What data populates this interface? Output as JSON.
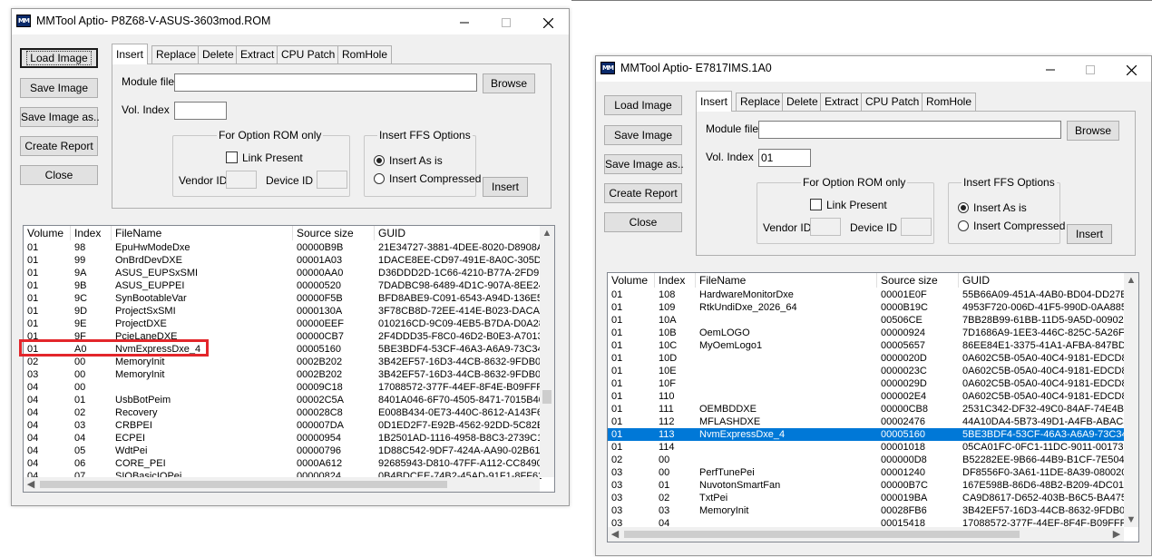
{
  "window_a": {
    "title": "MMTool Aptio- P8Z68-V-ASUS-3603mod.ROM",
    "buttons": {
      "load": "Load Image",
      "save": "Save Image",
      "save_as": "Save Image as..",
      "report": "Create Report",
      "close": "Close"
    },
    "tabs": [
      "Insert",
      "Replace",
      "Delete",
      "Extract",
      "CPU Patch",
      "RomHole"
    ],
    "module_file_label": "Module file",
    "module_file_value": "",
    "browse": "Browse",
    "vol_index_label": "Vol. Index",
    "vol_index_value": "",
    "option_rom_title": "For Option ROM only",
    "link_present": "Link Present",
    "vendor_id": "Vendor ID",
    "device_id": "Device ID",
    "ffs_title": "Insert FFS Options",
    "insert_as_is": "Insert As is",
    "insert_compressed": "Insert Compressed",
    "insert_button": "Insert",
    "columns": [
      "Volume",
      "Index",
      "FileName",
      "Source size",
      "GUID"
    ],
    "rows": [
      [
        "01",
        "98",
        "EpuHwModeDxe",
        "00000B9B",
        "21E34727-3881-4DEE-8020-D8908A"
      ],
      [
        "01",
        "99",
        "OnBrdDevDXE",
        "00001A03",
        "1DACE8EE-CD97-491E-8A0C-305D6"
      ],
      [
        "01",
        "9A",
        "ASUS_EUPSxSMI",
        "00000AA0",
        "D36DDD2D-1C66-4210-B77A-2FD9F"
      ],
      [
        "01",
        "9B",
        "ASUS_EUPPEI",
        "00000520",
        "7DADBC98-6489-4D1C-907A-8EE24"
      ],
      [
        "01",
        "9C",
        "SynBootableVar",
        "00000F5B",
        "BFD8ABE9-C091-6543-A94D-136E5E"
      ],
      [
        "01",
        "9D",
        "ProjectSxSMI",
        "0000130A",
        "3F78CB8D-72EE-414E-B023-DACA0"
      ],
      [
        "01",
        "9E",
        "ProjectDXE",
        "00000EEF",
        "010216CD-9C09-4EB5-B7DA-D0A28"
      ],
      [
        "01",
        "9F",
        "PcieLaneDXE",
        "00000CB7",
        "2F4DDD35-F8C0-46D2-B0E3-A7013"
      ],
      [
        "01",
        "A0",
        "NvmExpressDxe_4",
        "00005160",
        "5BE3BDF4-53CF-46A3-A6A9-73C34"
      ],
      [
        "02",
        "00",
        "MemoryInit",
        "0002B202",
        "3B42EF57-16D3-44CB-8632-9FDB06"
      ],
      [
        "03",
        "00",
        "MemoryInit",
        "0002B202",
        "3B42EF57-16D3-44CB-8632-9FDB06"
      ],
      [
        "04",
        "00",
        "",
        "00009C18",
        "17088572-377F-44EF-8F4E-B09FFF4"
      ],
      [
        "04",
        "01",
        "UsbBotPeim",
        "00002C5A",
        "8401A046-6F70-4505-8471-7015B40"
      ],
      [
        "04",
        "02",
        "Recovery",
        "000028C8",
        "E008B434-0E73-440C-8612-A143F6A"
      ],
      [
        "04",
        "03",
        "CRBPEI",
        "000007DA",
        "0D1ED2F7-E92B-4562-92DD-5C82E"
      ],
      [
        "04",
        "04",
        "ECPEI",
        "00000954",
        "1B2501AD-1116-4958-B8C3-2739C1"
      ],
      [
        "04",
        "05",
        "WdtPei",
        "00000796",
        "1D88C542-9DF7-424A-AA90-02B61F"
      ],
      [
        "04",
        "06",
        "CORE_PEI",
        "0000A612",
        "92685943-D810-47FF-A112-CC8490"
      ],
      [
        "04",
        "07",
        "SIOBasicIOPei",
        "00000824",
        "0B4BDCEE-74B2-45AD-91F1-8FF634"
      ]
    ],
    "highlighted_row": 8
  },
  "window_b": {
    "title": "MMTool Aptio- E7817IMS.1A0",
    "buttons": {
      "load": "Load Image",
      "save": "Save Image",
      "save_as": "Save Image as..",
      "report": "Create Report",
      "close": "Close"
    },
    "tabs": [
      "Insert",
      "Replace",
      "Delete",
      "Extract",
      "CPU Patch",
      "RomHole"
    ],
    "module_file_label": "Module file",
    "module_file_value": "",
    "browse": "Browse",
    "vol_index_label": "Vol. Index",
    "vol_index_value": "01",
    "option_rom_title": "For Option ROM only",
    "link_present": "Link Present",
    "vendor_id": "Vendor ID",
    "device_id": "Device ID",
    "ffs_title": "Insert FFS Options",
    "insert_as_is": "Insert As is",
    "insert_compressed": "Insert Compressed",
    "insert_button": "Insert",
    "columns": [
      "Volume",
      "Index",
      "FileName",
      "Source size",
      "GUID"
    ],
    "rows": [
      [
        "01",
        "108",
        "HardwareMonitorDxe",
        "00001E0F",
        "55B66A09-451A-4AB0-BD04-DD27E"
      ],
      [
        "01",
        "109",
        "RtkUndiDxe_2026_64",
        "0000B19C",
        "4953F720-006D-41F5-990D-0AA885"
      ],
      [
        "01",
        "10A",
        "",
        "00506CE",
        "7BB28B99-61BB-11D5-9A5D-009027"
      ],
      [
        "01",
        "10B",
        "OemLOGO",
        "00000924",
        "7D1686A9-1EE3-446C-825C-5A26F4"
      ],
      [
        "01",
        "10C",
        "MyOemLogo1",
        "00005657",
        "86EE84E1-3375-41A1-AFBA-847BD2"
      ],
      [
        "01",
        "10D",
        "",
        "0000020D",
        "0A602C5B-05A0-40C4-9181-EDCD89"
      ],
      [
        "01",
        "10E",
        "",
        "0000023C",
        "0A602C5B-05A0-40C4-9181-EDCD89"
      ],
      [
        "01",
        "10F",
        "",
        "0000029D",
        "0A602C5B-05A0-40C4-9181-EDCD89"
      ],
      [
        "01",
        "110",
        "",
        "000002E4",
        "0A602C5B-05A0-40C4-9181-EDCD89"
      ],
      [
        "01",
        "111",
        "OEMBDDXE",
        "00000CB8",
        "2531C342-DF32-49C0-84AF-74E4BC"
      ],
      [
        "01",
        "112",
        "MFLASHDXE",
        "00002476",
        "44A10DA4-5B73-49D1-A4FB-ABAC3"
      ],
      [
        "01",
        "113",
        "NvmExpressDxe_4",
        "00005160",
        "5BE3BDF4-53CF-46A3-A6A9-73C344"
      ],
      [
        "01",
        "114",
        "",
        "00001018",
        "05CA01FC-0FC1-11DC-9011-001731"
      ],
      [
        "02",
        "00",
        "",
        "000000D8",
        "B52282EE-9B66-44B9-B1CF-7E5040"
      ],
      [
        "03",
        "00",
        "PerfTunePei",
        "00001240",
        "DF8556F0-3A61-11DE-8A39-080020"
      ],
      [
        "03",
        "01",
        "NuvotonSmartFan",
        "00000B7C",
        "167E598B-86D6-48B2-B209-4DC012"
      ],
      [
        "03",
        "02",
        "TxtPei",
        "000019BA",
        "CA9D8617-D652-403B-B6C5-BA4757"
      ],
      [
        "03",
        "03",
        "MemoryInit",
        "00028FB6",
        "3B42EF57-16D3-44CB-8632-9FDB06"
      ],
      [
        "03",
        "04",
        "",
        "00015418",
        "17088572-377F-44EF-8F4F-B09FFF4"
      ]
    ],
    "selected_row": 11
  }
}
